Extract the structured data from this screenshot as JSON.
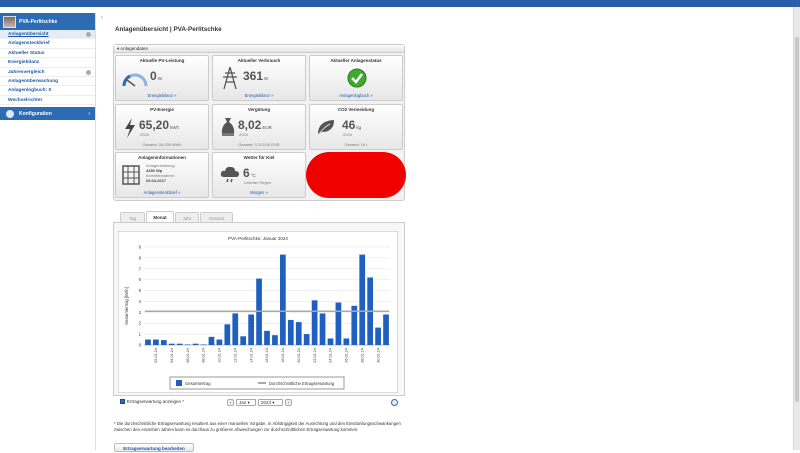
{
  "sidebar": {
    "title": "PVA-Perlitschke",
    "items": [
      {
        "label": "Anlagenübersicht"
      },
      {
        "label": "Anlagensteckbrief"
      },
      {
        "label": "Aktueller Status"
      },
      {
        "label": "Energiebilanz"
      },
      {
        "label": "Jahresvergleich"
      },
      {
        "label": "Anlagenüberwachung"
      },
      {
        "label": "Anlagenlogbuch: 0"
      },
      {
        "label": "Wechselrichter"
      }
    ],
    "config_label": "Konfiguration"
  },
  "page": {
    "title": "Anlagenübersicht | PVA-Perlitschke"
  },
  "panel": {
    "header": "▾ Anlagendaten",
    "tiles": {
      "pv": {
        "title": "Aktuelle PV-Leistung",
        "value": "0",
        "unit": "W",
        "link": "Energiebilanz »"
      },
      "consumption": {
        "title": "Aktueller Verbrauch",
        "value": "361",
        "unit": "W",
        "link": "Energiebilanz »"
      },
      "status": {
        "title": "Aktueller Anlagenstatus",
        "link": "Anlagenlogbuch »"
      },
      "energy": {
        "title": "PV-Energie",
        "value": "65,20",
        "unit": "kWh",
        "year": "2024",
        "total": "Gesamt: 26,039 MWh"
      },
      "payment": {
        "title": "Vergütung",
        "value": "8,02",
        "unit": "EUR",
        "year": "2024",
        "total": "Gesamt: 3.313,00 EUR"
      },
      "co2": {
        "title": "CO2 Vermeidung",
        "value": "46",
        "unit": "kg",
        "year": "2024",
        "total": "Gesamt: 19 t"
      },
      "info": {
        "title": "Anlageninformationen",
        "line1": "Anlagenleistung:",
        "power": "4280 Wp",
        "line3": "Inbetriebnahme:",
        "date": "03.04.2017",
        "link": "Anlagensteckbrief »"
      },
      "weather": {
        "title": "Wetter für Kiel",
        "value": "6",
        "unit": "°C",
        "desc": "Leichter Regen",
        "link": "Morgen »"
      }
    }
  },
  "tabs": [
    "Tag",
    "Monat",
    "Jahr",
    "Gesamt"
  ],
  "active_tab": "Monat",
  "chart_data": {
    "type": "bar",
    "title": "PVA-Perlitschke: Januar 2024",
    "ylabel": "Gesamtertrag [kWh]",
    "xlabel": "",
    "ylim": [
      0,
      9
    ],
    "yticks": [
      0,
      1,
      2,
      3,
      4,
      5,
      6,
      7,
      8,
      9
    ],
    "categories": [
      "01.01.24",
      "02.01.24",
      "03.01.24",
      "04.01.24",
      "05.01.24",
      "06.01.24",
      "07.01.24",
      "08.01.24",
      "09.01.24",
      "10.01.24",
      "11.01.24",
      "12.01.24",
      "13.01.24",
      "14.01.24",
      "15.01.24",
      "16.01.24",
      "17.01.24",
      "18.01.24",
      "19.01.24",
      "20.01.24",
      "21.01.24",
      "22.01.24",
      "23.01.24",
      "24.01.24",
      "25.01.24",
      "26.01.24",
      "27.01.24",
      "28.01.24",
      "29.01.24",
      "30.01.24",
      "31.01.24"
    ],
    "xtick_labels": [
      "02.01.24",
      "04.01.24",
      "06.01.24",
      "08.01.24",
      "10.01.24",
      "12.01.24",
      "14.01.24",
      "16.01.24",
      "18.01.24",
      "20.01.24",
      "22.01.24",
      "24.01.24",
      "26.01.24",
      "28.01.24",
      "30.01.24"
    ],
    "series": [
      {
        "name": "Gesamtertrag",
        "values": [
          0.5,
          0.5,
          0.45,
          0.12,
          0.12,
          0.05,
          0.12,
          0.05,
          0.75,
          0.5,
          1.9,
          2.9,
          0.8,
          2.8,
          6.1,
          1.3,
          0.9,
          8.3,
          2.3,
          2.1,
          1.0,
          4.1,
          2.9,
          0.6,
          3.9,
          0.6,
          3.6,
          8.3,
          6.2,
          1.6,
          2.8
        ],
        "color": "#1f5fbf"
      },
      {
        "name": "Durchschnittliche Ertragserwartung",
        "value": 3.1,
        "color": "#aaaaaa"
      }
    ],
    "legend": "bottom"
  },
  "controls": {
    "checkbox_label": "Ertragserwartung anzeigen *",
    "month": "Jan",
    "year": "2024"
  },
  "footnote": "* Die durchschnittliche Ertragserwartung resultiert aus einer manuellen Vorgabe. In Abhängigkeit der Ausrichtung und den Einstrahlungsschwankungen zwischen den einzelnen Jahren kann es durchaus zu größeren Abweichungen zur durchschnittlichen Ertragserwartung kommen.",
  "edit_button": "Ertragserwartung bearbeiten",
  "colors": {
    "accent": "#2d6cb5",
    "link": "#1d5aa8",
    "bar": "#1f5fbf",
    "expectation": "#aaaaaa",
    "redaction": "#f20000"
  }
}
